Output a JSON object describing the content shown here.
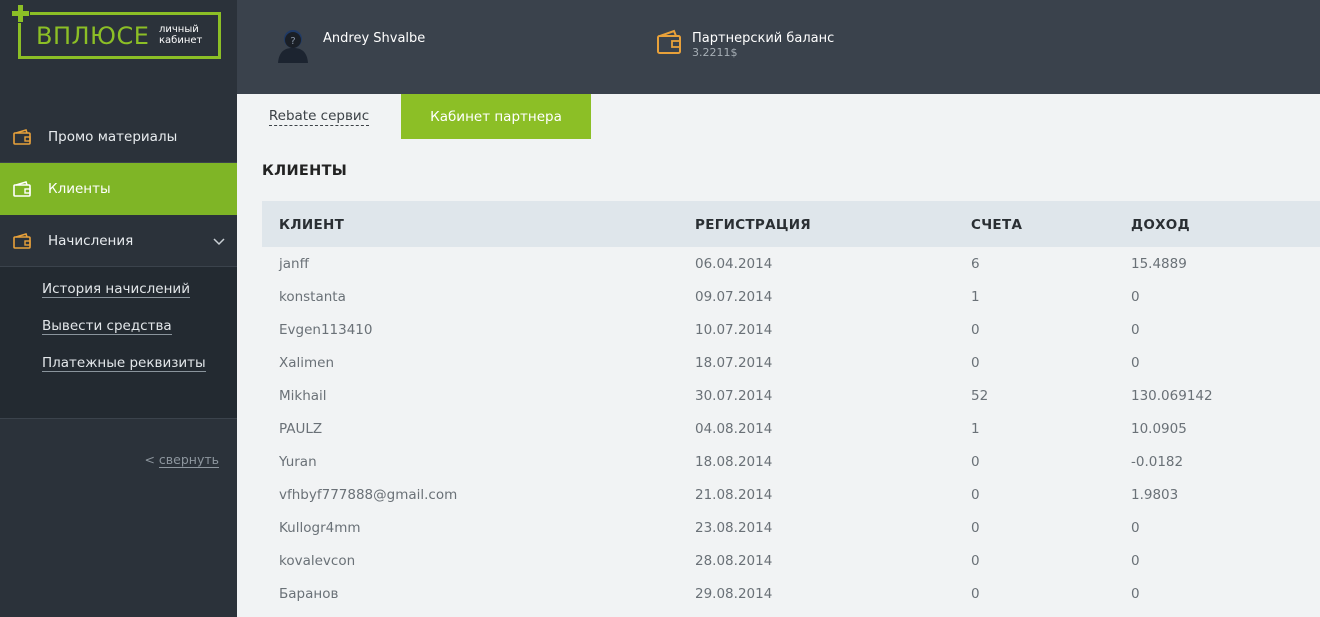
{
  "logo": {
    "main": "ВПЛЮСЕ",
    "sub_line1": "личный",
    "sub_line2": "кабинет"
  },
  "sidebar": {
    "items": [
      {
        "label": "Промо материалы",
        "icon": "wallet-icon"
      },
      {
        "label": "Клиенты",
        "icon": "wallet-icon",
        "active": true
      },
      {
        "label": "Начисления",
        "icon": "wallet-icon",
        "expanded": true
      }
    ],
    "subitems": [
      "История начислений",
      "Вывести средства",
      "Платежные реквизиты"
    ],
    "collapse_arrow": "<",
    "collapse_label": "свернуть"
  },
  "header": {
    "user_name": "Andrey Shvalbe",
    "balance_label": "Партнерский баланс",
    "balance_value": "3.2211$"
  },
  "tabs": [
    {
      "label": "Rebate сервис",
      "active": false
    },
    {
      "label": "Кабинет партнера",
      "active": true
    }
  ],
  "section_title": "КЛИЕНТЫ",
  "table": {
    "headers": [
      "КЛИЕНТ",
      "РЕГИСТРАЦИЯ",
      "СЧЕТА",
      "ДОХОД"
    ],
    "rows": [
      [
        "janff",
        "06.04.2014",
        "6",
        "15.4889"
      ],
      [
        "konstanta",
        "09.07.2014",
        "1",
        "0"
      ],
      [
        "Evgen113410",
        "10.07.2014",
        "0",
        "0"
      ],
      [
        "Xalimen",
        "18.07.2014",
        "0",
        "0"
      ],
      [
        "Mikhail",
        "30.07.2014",
        "52",
        "130.069142"
      ],
      [
        "PAULZ",
        "04.08.2014",
        "1",
        "10.0905"
      ],
      [
        "Yuran",
        "18.08.2014",
        "0",
        "-0.0182"
      ],
      [
        "vfhbyf777888@gmail.com",
        "21.08.2014",
        "0",
        "1.9803"
      ],
      [
        "Kullogr4mm",
        "23.08.2014",
        "0",
        "0"
      ],
      [
        "kovalevcon",
        "28.08.2014",
        "0",
        "0"
      ],
      [
        "Баранов",
        "29.08.2014",
        "0",
        "0"
      ]
    ]
  },
  "colors": {
    "accent": "#8cbf26",
    "sidebar": "#2b323a",
    "header": "#3a424c",
    "wallet_icon": "#e8a13a"
  }
}
